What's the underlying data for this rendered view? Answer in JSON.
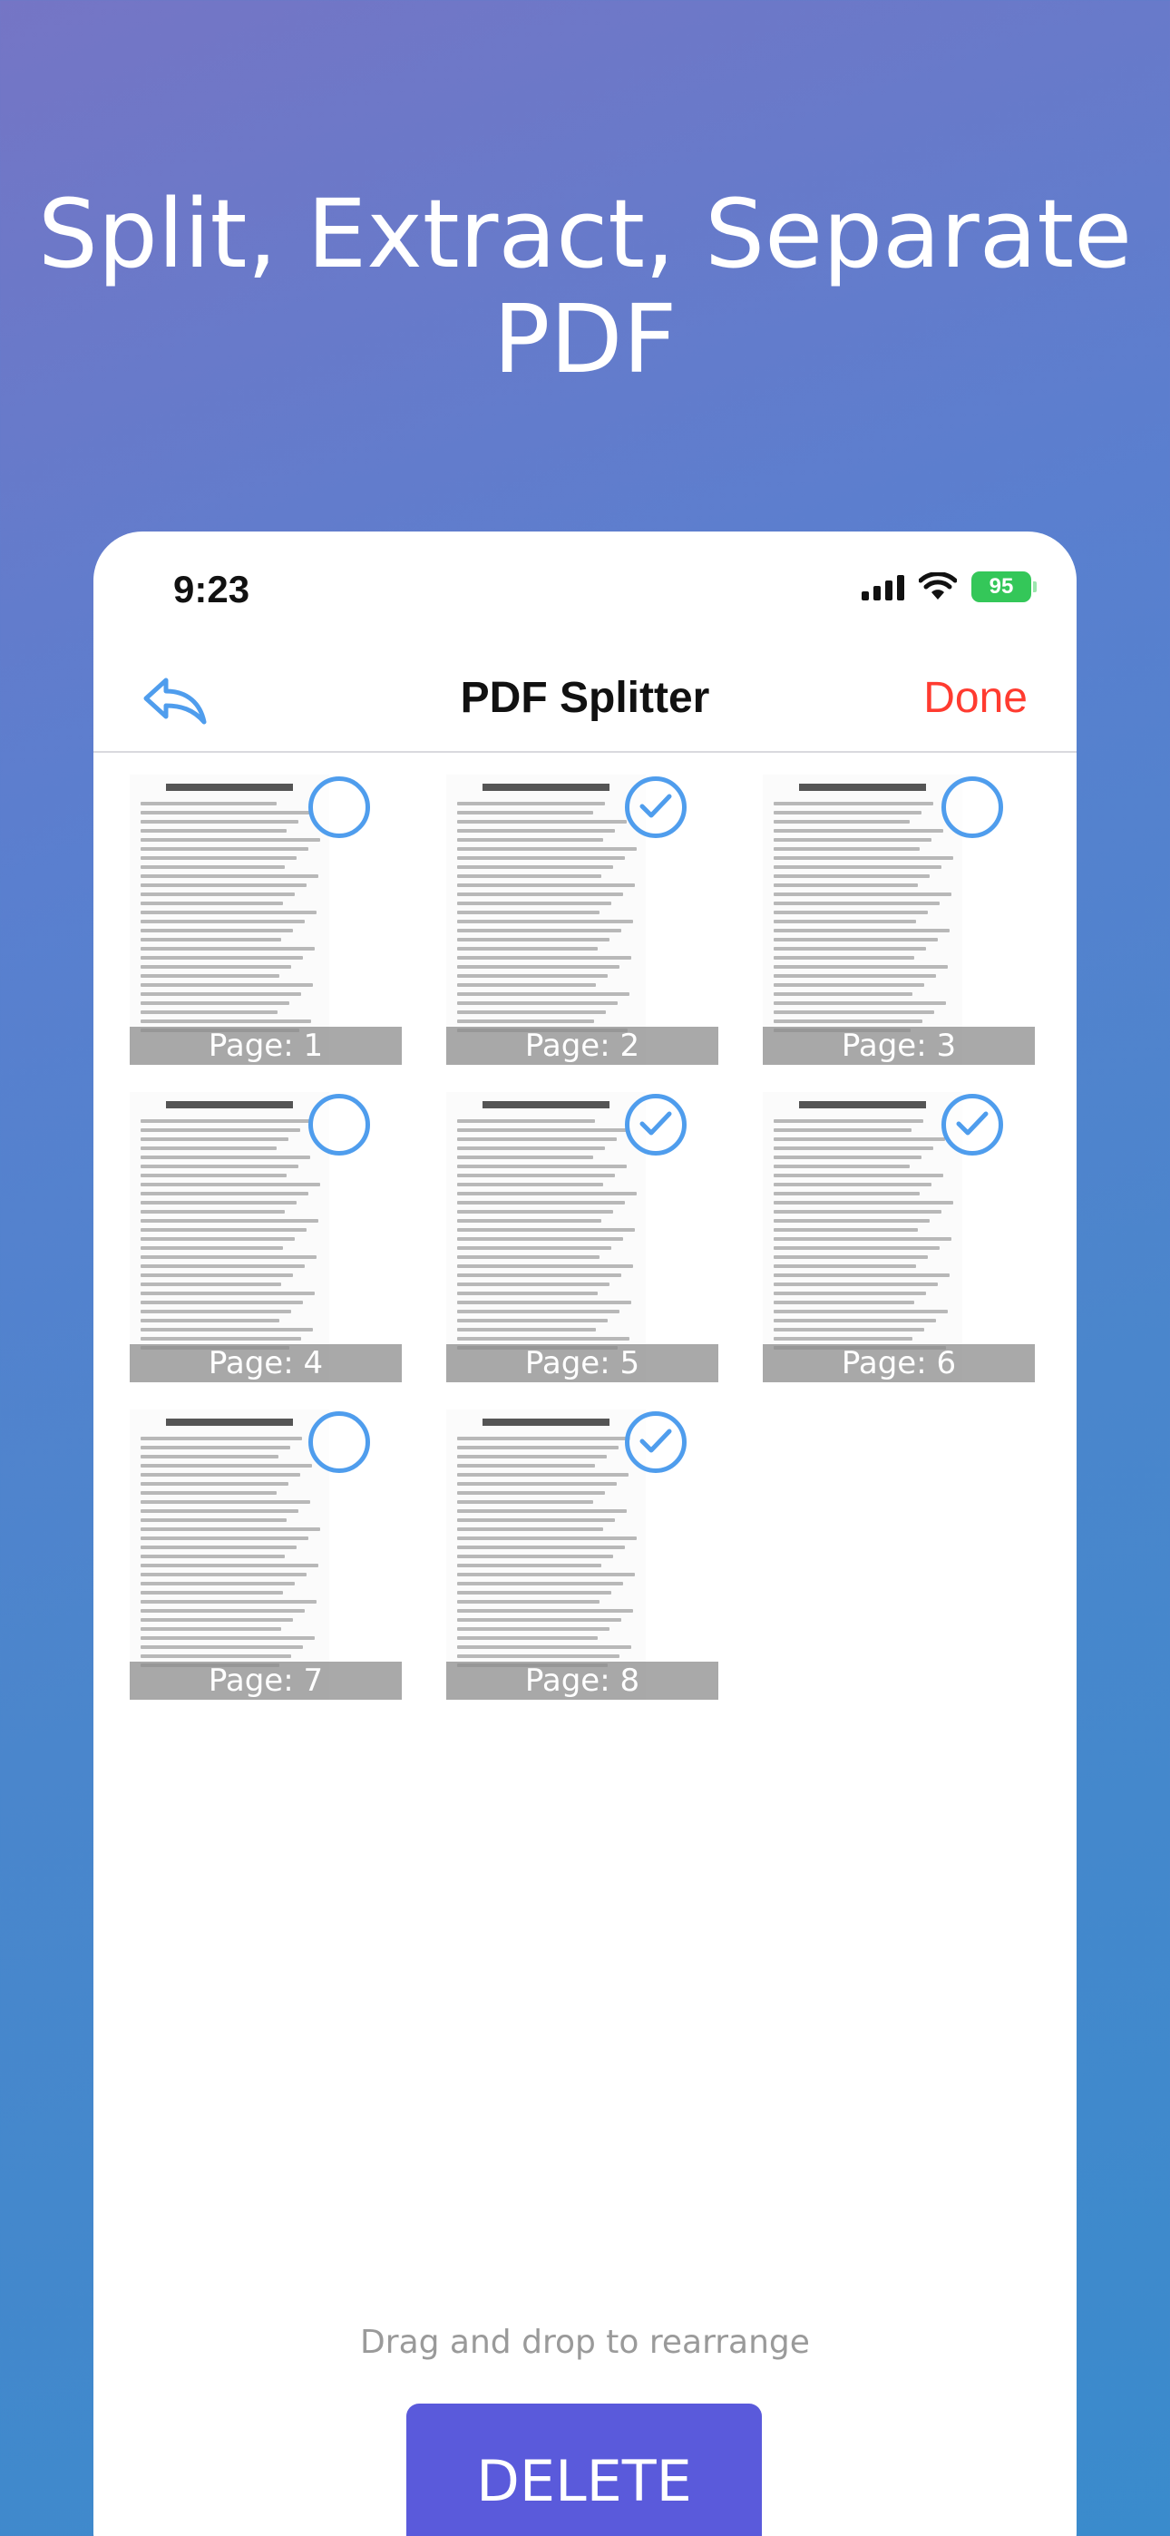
{
  "headline": {
    "line1": "Split, Extract, Separate",
    "line2": "PDF"
  },
  "status_bar": {
    "time": "9:23",
    "battery": "95"
  },
  "navbar": {
    "title": "PDF Splitter",
    "done_label": "Done"
  },
  "pages": [
    {
      "label": "Page: 1",
      "selected": false
    },
    {
      "label": "Page: 2",
      "selected": true
    },
    {
      "label": "Page: 3",
      "selected": false
    },
    {
      "label": "Page: 4",
      "selected": false
    },
    {
      "label": "Page: 5",
      "selected": true
    },
    {
      "label": "Page: 6",
      "selected": true
    },
    {
      "label": "Page: 7",
      "selected": false
    },
    {
      "label": "Page: 8",
      "selected": true
    }
  ],
  "footer": {
    "hint": "Drag and drop to rearrange",
    "delete_label": "DELETE"
  },
  "colors": {
    "accent": "#4f9ded",
    "done": "#ff3b30",
    "delete": "#5a5adb",
    "battery": "#34c759"
  }
}
